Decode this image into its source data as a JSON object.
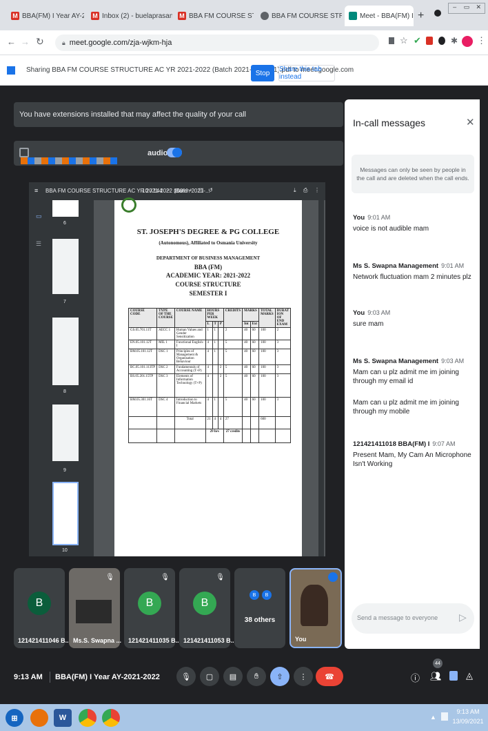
{
  "browser": {
    "tabs": [
      {
        "label": "BBA(FM) I Year AY-2021-2"
      },
      {
        "label": "Inbox (2) - buelaprasannak"
      },
      {
        "label": "BBA FM COURSE STRUCTU"
      },
      {
        "label": "BBA FM COURSE STRU"
      },
      {
        "label": "Meet - BBA(FM) I Year"
      }
    ],
    "new_tab": "+",
    "url": "meet.google.com/zja-wjkm-hja"
  },
  "share_bar": {
    "message": "Sharing BBA FM COURSE STRUCTURE AC YR 2021-2022 (Batch 2021-2024) (1).pdf to meet.google.com",
    "stop_label": "Stop",
    "share_tab_label": "Share this tab instead"
  },
  "meet": {
    "warning": "You have extensions installed that may affect the quality of your call",
    "audio_label": "audio",
    "pdf_toolbar": {
      "title": "BBA FM COURSE STRUCTURE AC YR 2021-2022 (Batch 2021-...",
      "page": "10",
      "pages": "/ 144",
      "zoom": "100%"
    },
    "thumb_numbers": [
      "6",
      "7",
      "8",
      "9",
      "10"
    ],
    "document": {
      "college": "ST. JOSEPH'S DEGREE & PG COLLEGE",
      "affiliation": "(Autonomous), Affiliated to Osmania University",
      "dept": "DEPARTMENT OF BUSINESS MANAGEMENT",
      "program": "BBA (FM)",
      "year": "ACADEMIC YEAR: 2021-2022",
      "heading": "COURSE STRUCTURE",
      "semester": "SEMESTER I",
      "headers": [
        "COURSE CODE",
        "TYPE OF THE COURSE",
        "COURSE NAME",
        "HOURS PER WEEK",
        "CREDITS",
        "MARKS",
        "TOTAL MARKS",
        "DURAT ION OF END EXAM"
      ],
      "subheaders": [
        "L",
        "T",
        "P",
        "Int",
        "Ext"
      ],
      "rows": [
        {
          "code": "GS.05.701.11T",
          "type": "AECC 1",
          "name": "Human Values and Gender Sensitization",
          "l": "1",
          "t": "1",
          "p": "",
          "credits": "2",
          "int": "40",
          "ext": "60",
          "total": "100",
          "dur": "2"
        },
        {
          "code": "EN.05.101.12T",
          "type": "MIL 1",
          "name": "Functional English-I",
          "l": "4",
          "t": "1",
          "p": "",
          "credits": "5",
          "int": "40",
          "ext": "60",
          "total": "100",
          "dur": "3"
        },
        {
          "code": "BM.05.101.12T",
          "type": "DSC 1",
          "name": "Principles of Management & Organisation Behaviour",
          "l": "4",
          "t": "1",
          "p": "",
          "credits": "5",
          "int": "40",
          "ext": "60",
          "total": "100",
          "dur": "3"
        },
        {
          "code": "BC.05.101.113TP",
          "type": "DSC 2",
          "name": "Fundamentals of Accounting (T+P)",
          "l": "4",
          "t": "",
          "p": "2",
          "credits": "5",
          "int": "40",
          "ext": "60",
          "total": "100",
          "dur": "3"
        },
        {
          "code": "BS.05.201.15TP",
          "type": "DSC 3",
          "name": "Elements of Information Technology (T+P)",
          "l": "4",
          "t": "",
          "p": "2",
          "credits": "5",
          "int": "40",
          "ext": "60",
          "total": "100",
          "dur": "3"
        },
        {
          "code": "BM.05.301.16T",
          "type": "DSC 4",
          "name": "Introduction to Financial Markets",
          "l": "4",
          "t": "1",
          "p": "",
          "credits": "5",
          "int": "40",
          "ext": "60",
          "total": "100",
          "dur": "3"
        }
      ],
      "total_label": "Total",
      "total_l": "21",
      "total_t": "4",
      "total_p": "4",
      "total_credits": "27",
      "total_marks": "600",
      "hrs_label": "29 hrs",
      "credits_label": "27 credits"
    },
    "participants": [
      {
        "label": "121421411046 B...",
        "initial": "B",
        "color": "#0b5d3b"
      },
      {
        "label": "Ms.S. Swapna ..."
      },
      {
        "label": "121421411035 B...",
        "initial": "B",
        "color": "#34a853"
      },
      {
        "label": "121421411053 B...",
        "initial": "B",
        "color": "#34a853"
      },
      {
        "label": "38 others",
        "initial": "B"
      },
      {
        "label": "You"
      }
    ],
    "meeting_time": "9:13 AM",
    "meeting_name": "BBA(FM) I Year AY-2021-2022",
    "people_count": "44"
  },
  "chat": {
    "title": "In-call messages",
    "notice": "Messages can only be seen by people in the call and are deleted when the call ends.",
    "messages": [
      {
        "sender": "You",
        "time": "9:01 AM",
        "text": "voice is not audible mam"
      },
      {
        "sender": "Ms S. Swapna Management",
        "time": "9:01 AM",
        "text": "Network fluctuation mam 2 minutes plz"
      },
      {
        "sender": "You",
        "time": "9:03 AM",
        "text": "sure mam"
      },
      {
        "sender": "Ms S. Swapna Management",
        "time": "9:03 AM",
        "text": "Mam can u plz admit me im joining through my email id",
        "text2": "Mam can u plz admit me im joining through my mobile"
      },
      {
        "sender": "121421411018 BBA(FM) I",
        "time": "9:07 AM",
        "text": "Present Mam, My Cam An Microphone Isn't Working"
      }
    ],
    "input_placeholder": "Send a message to everyone"
  },
  "taskbar": {
    "time": "9:13 AM",
    "date": "13/09/2021"
  }
}
